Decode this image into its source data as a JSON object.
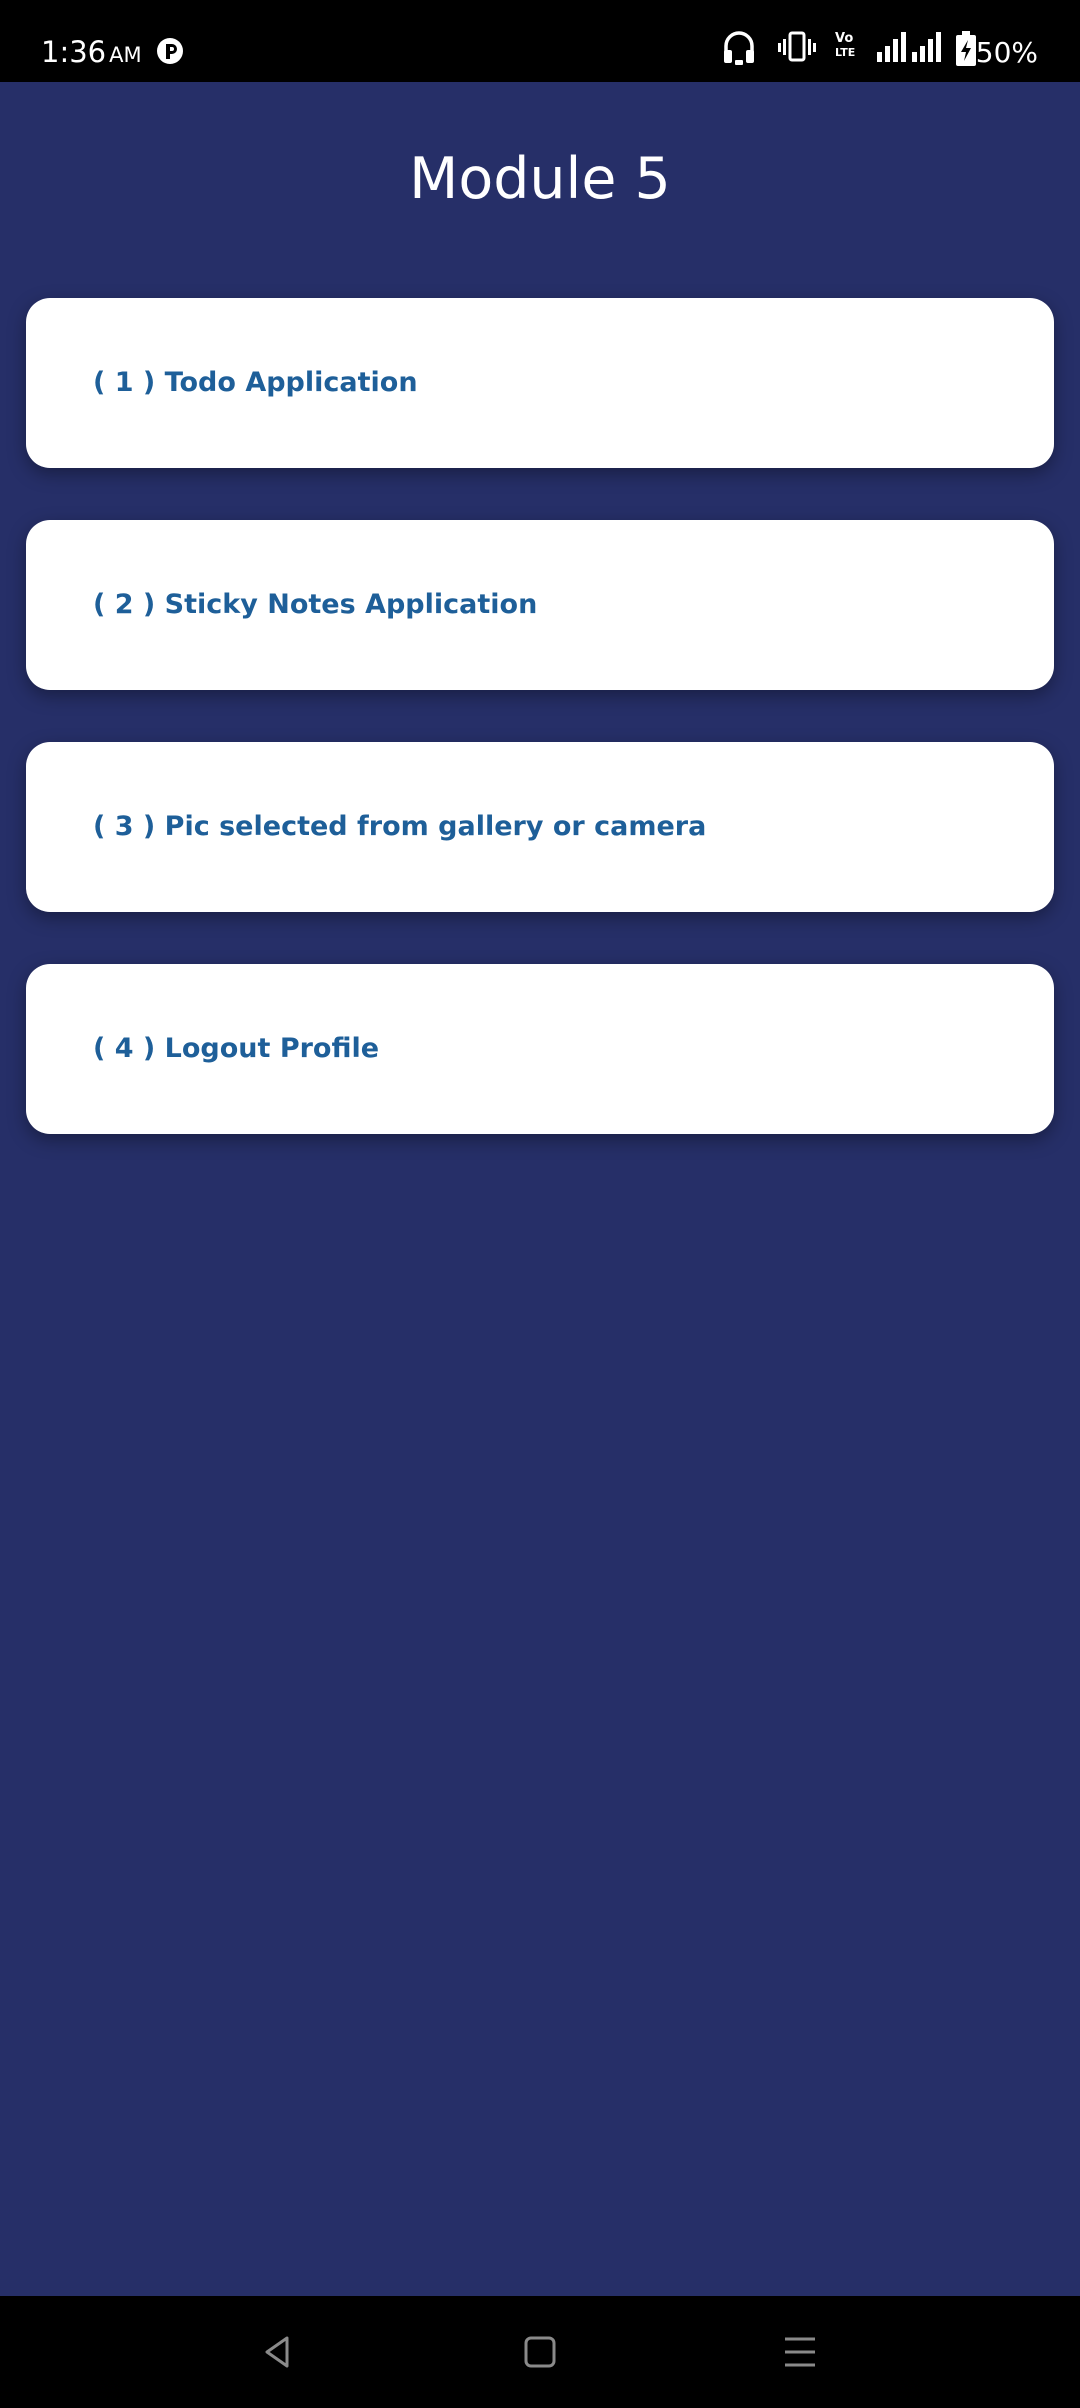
{
  "status_bar": {
    "time": "1:36",
    "ampm": "AM",
    "battery": "50%",
    "icons": [
      "app-notification-icon",
      "headset-icon",
      "vibrate-icon",
      "volte-icon",
      "signal-1-icon",
      "signal-2-icon",
      "battery-charging-icon"
    ]
  },
  "page": {
    "title": "Module 5",
    "background_color": "#262f68"
  },
  "menu": {
    "items": [
      {
        "label": "( 1 ) Todo Application"
      },
      {
        "label": "( 2 ) Sticky Notes Application"
      },
      {
        "label": "( 3 ) Pic selected from gallery or camera"
      },
      {
        "label": "( 4 ) Logout Profile"
      }
    ],
    "label_color": "#1e5f99"
  },
  "volte_text": {
    "top": "Vo",
    "bottom": "LTE"
  },
  "nav_bar": {
    "buttons": [
      "back-icon",
      "home-icon",
      "recents-icon"
    ]
  }
}
